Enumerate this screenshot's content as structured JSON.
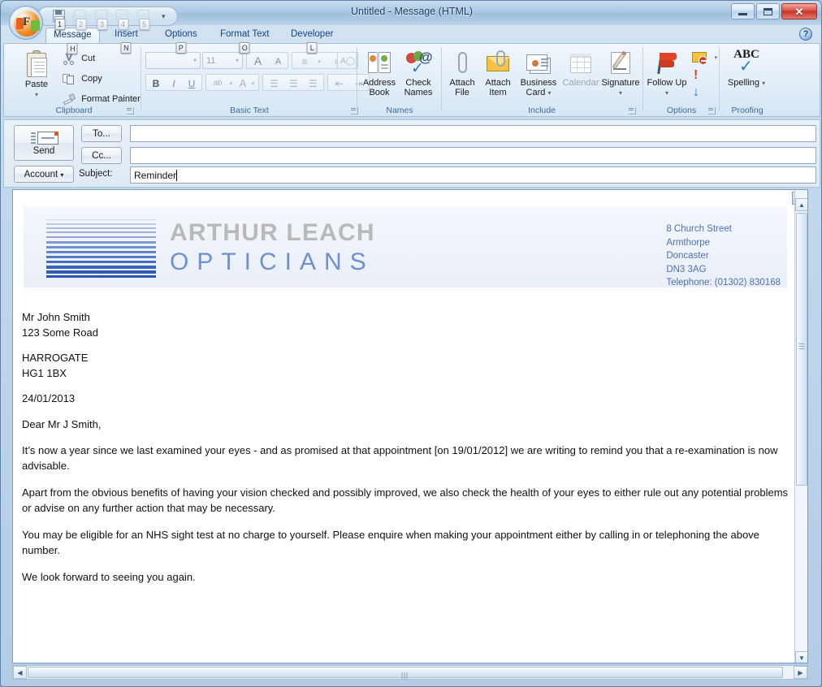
{
  "window": {
    "title": "Untitled - Message (HTML)",
    "controls": {
      "minimize": "minimize",
      "maximize": "maximize",
      "close": "close"
    }
  },
  "quick_access": {
    "office_button_keytip": "F",
    "items": [
      {
        "icon": "save-icon",
        "keytip": "1"
      },
      {
        "icon": "qat-placeholder-icon",
        "keytip": "2"
      },
      {
        "icon": "qat-placeholder-icon",
        "keytip": "3"
      },
      {
        "icon": "qat-placeholder-icon",
        "keytip": "4"
      },
      {
        "icon": "qat-placeholder-icon",
        "keytip": "5"
      }
    ],
    "customize_arrow": "▾"
  },
  "ribbon": {
    "tabs": [
      {
        "label": "Message",
        "keytip": "H",
        "active": true
      },
      {
        "label": "Insert",
        "keytip": "N",
        "active": false
      },
      {
        "label": "Options",
        "keytip": "P",
        "active": false
      },
      {
        "label": "Format Text",
        "keytip": "O",
        "active": false
      },
      {
        "label": "Developer",
        "keytip": "L",
        "active": false
      }
    ],
    "help_icon": "?",
    "groups": {
      "clipboard": {
        "label": "Clipboard",
        "paste": "Paste",
        "cut": "Cut",
        "copy": "Copy",
        "format_painter": "Format Painter"
      },
      "basic_text": {
        "label": "Basic Text",
        "font_name": "",
        "font_size": "11",
        "grow_font": "A",
        "shrink_font": "A"
      },
      "names": {
        "label": "Names",
        "address_book": "Address Book",
        "check_names": "Check Names"
      },
      "include": {
        "label": "Include",
        "attach_file": "Attach File",
        "attach_item": "Attach Item",
        "business_card": "Business Card",
        "calendar": "Calendar",
        "signature": "Signature"
      },
      "options": {
        "label": "Options",
        "follow_up": "Follow Up"
      },
      "proofing": {
        "label": "Proofing",
        "spelling": "Spelling",
        "spelling_icon_text": "ABC"
      }
    }
  },
  "compose": {
    "send_button": "Send",
    "account_button": "Account",
    "to_button": "To...",
    "cc_button": "Cc...",
    "to_value": "",
    "cc_value": "",
    "subject_label": "Subject:",
    "subject_value": "Reminder"
  },
  "letter": {
    "letterhead": {
      "brand_line1": "ARTHUR LEACH",
      "brand_line2": "OPTICIANS",
      "address": [
        "8 Church Street",
        "Armthorpe",
        "Doncaster",
        "DN3 3AG",
        "Telephone: (01302) 830168"
      ]
    },
    "recipient": {
      "name": "Mr John Smith",
      "street": "123 Some Road",
      "town": "HARROGATE",
      "postcode": "HG1 1BX"
    },
    "date": "24/01/2013",
    "salutation": "Dear Mr J Smith,",
    "paragraphs": [
      "It’s now a year since we last examined your eyes - and as promised at that appointment [on 19/01/2012] we are writing to remind you that a re-examination is now advisable.",
      "Apart from the obvious benefits of having your vision checked and possibly improved, we also check the health of your eyes to either rule out any potential problems or advise on any further action that may be necessary.",
      "You may be eligible for an NHS sight test at no charge to yourself.  Please enquire when making your appointment either by calling in or telephoning the above number.",
      "We look forward to seeing you again."
    ]
  },
  "colors": {
    "brand_gray": "#b9b9b9",
    "brand_blue": "#6f8fd0",
    "address_blue": "#4f6fb5",
    "tab_text": "#15428b",
    "close_red": "#c8352a"
  }
}
